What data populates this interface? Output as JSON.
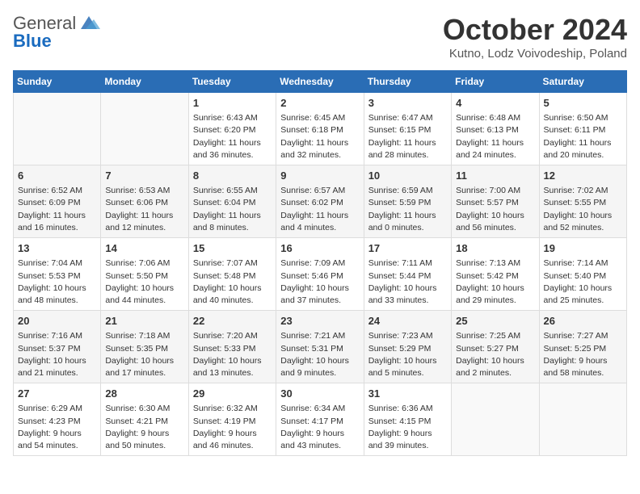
{
  "logo": {
    "general": "General",
    "blue": "Blue"
  },
  "title": "October 2024",
  "location": "Kutno, Lodz Voivodeship, Poland",
  "weekdays": [
    "Sunday",
    "Monday",
    "Tuesday",
    "Wednesday",
    "Thursday",
    "Friday",
    "Saturday"
  ],
  "weeks": [
    [
      {
        "day": "",
        "info": ""
      },
      {
        "day": "",
        "info": ""
      },
      {
        "day": "1",
        "info": "Sunrise: 6:43 AM\nSunset: 6:20 PM\nDaylight: 11 hours\nand 36 minutes."
      },
      {
        "day": "2",
        "info": "Sunrise: 6:45 AM\nSunset: 6:18 PM\nDaylight: 11 hours\nand 32 minutes."
      },
      {
        "day": "3",
        "info": "Sunrise: 6:47 AM\nSunset: 6:15 PM\nDaylight: 11 hours\nand 28 minutes."
      },
      {
        "day": "4",
        "info": "Sunrise: 6:48 AM\nSunset: 6:13 PM\nDaylight: 11 hours\nand 24 minutes."
      },
      {
        "day": "5",
        "info": "Sunrise: 6:50 AM\nSunset: 6:11 PM\nDaylight: 11 hours\nand 20 minutes."
      }
    ],
    [
      {
        "day": "6",
        "info": "Sunrise: 6:52 AM\nSunset: 6:09 PM\nDaylight: 11 hours\nand 16 minutes."
      },
      {
        "day": "7",
        "info": "Sunrise: 6:53 AM\nSunset: 6:06 PM\nDaylight: 11 hours\nand 12 minutes."
      },
      {
        "day": "8",
        "info": "Sunrise: 6:55 AM\nSunset: 6:04 PM\nDaylight: 11 hours\nand 8 minutes."
      },
      {
        "day": "9",
        "info": "Sunrise: 6:57 AM\nSunset: 6:02 PM\nDaylight: 11 hours\nand 4 minutes."
      },
      {
        "day": "10",
        "info": "Sunrise: 6:59 AM\nSunset: 5:59 PM\nDaylight: 11 hours\nand 0 minutes."
      },
      {
        "day": "11",
        "info": "Sunrise: 7:00 AM\nSunset: 5:57 PM\nDaylight: 10 hours\nand 56 minutes."
      },
      {
        "day": "12",
        "info": "Sunrise: 7:02 AM\nSunset: 5:55 PM\nDaylight: 10 hours\nand 52 minutes."
      }
    ],
    [
      {
        "day": "13",
        "info": "Sunrise: 7:04 AM\nSunset: 5:53 PM\nDaylight: 10 hours\nand 48 minutes."
      },
      {
        "day": "14",
        "info": "Sunrise: 7:06 AM\nSunset: 5:50 PM\nDaylight: 10 hours\nand 44 minutes."
      },
      {
        "day": "15",
        "info": "Sunrise: 7:07 AM\nSunset: 5:48 PM\nDaylight: 10 hours\nand 40 minutes."
      },
      {
        "day": "16",
        "info": "Sunrise: 7:09 AM\nSunset: 5:46 PM\nDaylight: 10 hours\nand 37 minutes."
      },
      {
        "day": "17",
        "info": "Sunrise: 7:11 AM\nSunset: 5:44 PM\nDaylight: 10 hours\nand 33 minutes."
      },
      {
        "day": "18",
        "info": "Sunrise: 7:13 AM\nSunset: 5:42 PM\nDaylight: 10 hours\nand 29 minutes."
      },
      {
        "day": "19",
        "info": "Sunrise: 7:14 AM\nSunset: 5:40 PM\nDaylight: 10 hours\nand 25 minutes."
      }
    ],
    [
      {
        "day": "20",
        "info": "Sunrise: 7:16 AM\nSunset: 5:37 PM\nDaylight: 10 hours\nand 21 minutes."
      },
      {
        "day": "21",
        "info": "Sunrise: 7:18 AM\nSunset: 5:35 PM\nDaylight: 10 hours\nand 17 minutes."
      },
      {
        "day": "22",
        "info": "Sunrise: 7:20 AM\nSunset: 5:33 PM\nDaylight: 10 hours\nand 13 minutes."
      },
      {
        "day": "23",
        "info": "Sunrise: 7:21 AM\nSunset: 5:31 PM\nDaylight: 10 hours\nand 9 minutes."
      },
      {
        "day": "24",
        "info": "Sunrise: 7:23 AM\nSunset: 5:29 PM\nDaylight: 10 hours\nand 5 minutes."
      },
      {
        "day": "25",
        "info": "Sunrise: 7:25 AM\nSunset: 5:27 PM\nDaylight: 10 hours\nand 2 minutes."
      },
      {
        "day": "26",
        "info": "Sunrise: 7:27 AM\nSunset: 5:25 PM\nDaylight: 9 hours\nand 58 minutes."
      }
    ],
    [
      {
        "day": "27",
        "info": "Sunrise: 6:29 AM\nSunset: 4:23 PM\nDaylight: 9 hours\nand 54 minutes."
      },
      {
        "day": "28",
        "info": "Sunrise: 6:30 AM\nSunset: 4:21 PM\nDaylight: 9 hours\nand 50 minutes."
      },
      {
        "day": "29",
        "info": "Sunrise: 6:32 AM\nSunset: 4:19 PM\nDaylight: 9 hours\nand 46 minutes."
      },
      {
        "day": "30",
        "info": "Sunrise: 6:34 AM\nSunset: 4:17 PM\nDaylight: 9 hours\nand 43 minutes."
      },
      {
        "day": "31",
        "info": "Sunrise: 6:36 AM\nSunset: 4:15 PM\nDaylight: 9 hours\nand 39 minutes."
      },
      {
        "day": "",
        "info": ""
      },
      {
        "day": "",
        "info": ""
      }
    ]
  ]
}
